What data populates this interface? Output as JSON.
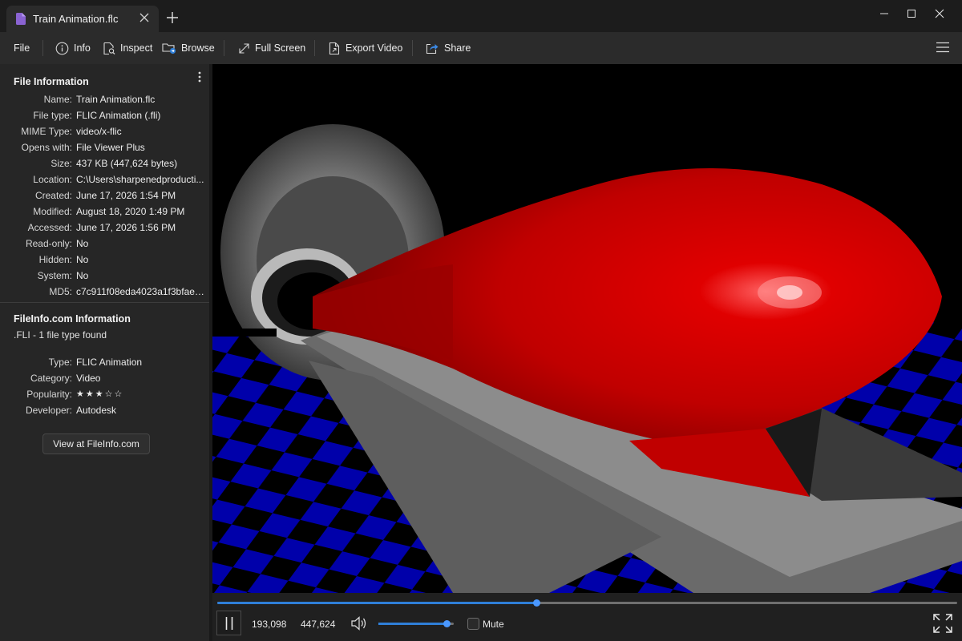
{
  "window": {
    "tab_title": "Train Animation.flc",
    "new_tab_label": "+"
  },
  "toolbar": {
    "file": "File",
    "info": "Info",
    "inspect": "Inspect",
    "browse": "Browse",
    "full_screen": "Full Screen",
    "export_video": "Export Video",
    "share": "Share"
  },
  "file_information": {
    "title": "File Information",
    "rows": [
      {
        "label": "Name:",
        "value": "Train Animation.flc"
      },
      {
        "label": "File type:",
        "value": "FLIC Animation (.fli)"
      },
      {
        "label": "MIME Type:",
        "value": "video/x-flic"
      },
      {
        "label": "Opens with:",
        "value": "File Viewer Plus"
      },
      {
        "label": "Size:",
        "value": "437 KB (447,624 bytes)"
      },
      {
        "label": "Location:",
        "value": "C:\\Users\\sharpenedproducti..."
      },
      {
        "label": "Created:",
        "value": "June 17, 2026 1:54 PM"
      },
      {
        "label": "Modified:",
        "value": "August 18, 2020 1:49 PM"
      },
      {
        "label": "Accessed:",
        "value": "June 17, 2026 1:56 PM"
      },
      {
        "label": "Read-only:",
        "value": "No"
      },
      {
        "label": "Hidden:",
        "value": "No"
      },
      {
        "label": "System:",
        "value": "No"
      },
      {
        "label": "MD5:",
        "value": "c7c911f08eda4023a1f3bfaeb7..."
      }
    ]
  },
  "fileinfo": {
    "title": "FileInfo.com Information",
    "subtitle": ".FLI - 1 file type found",
    "rows": [
      {
        "label": "Type:",
        "value": "FLIC Animation"
      },
      {
        "label": "Category:",
        "value": "Video"
      },
      {
        "label": "Popularity:",
        "value": "★★★☆☆"
      },
      {
        "label": "Developer:",
        "value": "Autodesk"
      }
    ],
    "button_label": "View at FileInfo.com"
  },
  "player": {
    "position": "193,098",
    "total": "447,624",
    "progress": 0.431,
    "volume": 0.9,
    "mute_label": "Mute",
    "muted": false,
    "accent_color": "#2f7fd8"
  },
  "colors": {
    "train": "#d40000",
    "floor_blue": "#0000aa",
    "background": "#000000"
  }
}
